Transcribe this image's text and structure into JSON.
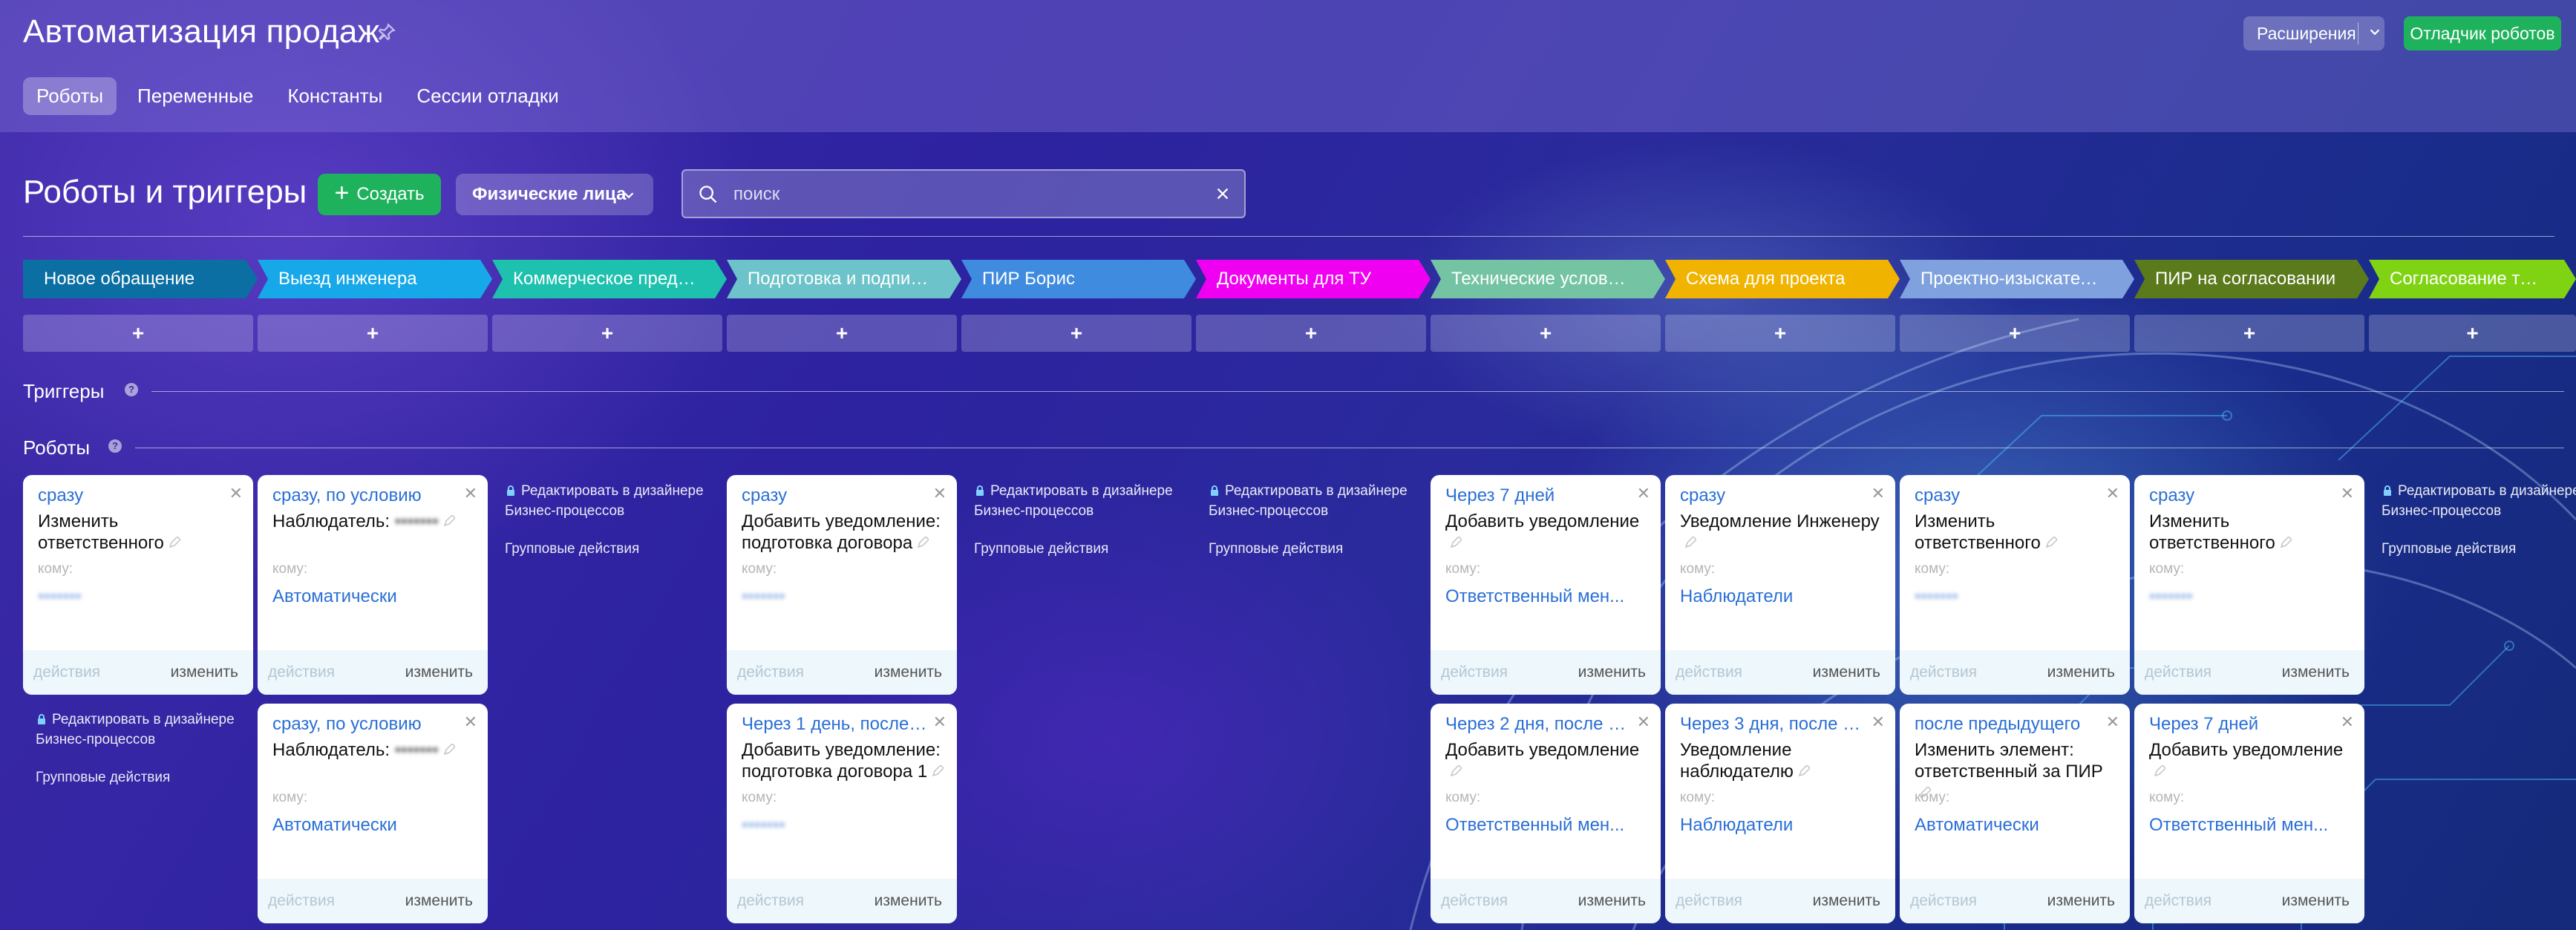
{
  "header": {
    "title": "Автоматизация продаж",
    "tabs": [
      {
        "label": "Роботы",
        "active": true
      },
      {
        "label": "Переменные"
      },
      {
        "label": "Константы"
      },
      {
        "label": "Сессии отладки"
      }
    ],
    "extensions_label": "Расширения",
    "debugger_label": "Отладчик роботов"
  },
  "toolbar": {
    "heading": "Роботы и триггеры",
    "create_label": "Создать",
    "filter_label": "Физические лица",
    "search_placeholder": "поиск"
  },
  "stages": [
    {
      "name": "Новое обращение",
      "color": "#0b6fa3"
    },
    {
      "name": "Выезд инженера",
      "color": "#16a8e8"
    },
    {
      "name": "Коммерческое предло...",
      "color": "#1ec1ae"
    },
    {
      "name": "Подготовка и подписа...",
      "color": "#6cc3c9"
    },
    {
      "name": "ПИР Борис",
      "color": "#3f8be0"
    },
    {
      "name": "Документы для ТУ",
      "color": "#f000f0"
    },
    {
      "name": "Технические условия (...",
      "color": "#74c4a4"
    },
    {
      "name": "Схема для проекта",
      "color": "#f0b400"
    },
    {
      "name": "Проектно-изыскательс...",
      "color": "#7fa2df"
    },
    {
      "name": "ПИР на согласовании",
      "color": "#5a7a1c"
    },
    {
      "name": "Согласование точки в...",
      "color": "#7fd313"
    }
  ],
  "add_label": "+",
  "sections": {
    "triggers": "Триггеры",
    "robots": "Роботы",
    "help": "?"
  },
  "common": {
    "to_label": "кому:",
    "actions_label": "действия",
    "edit_label": "изменить",
    "designer_line1": "Редактировать в дизайнере",
    "designer_line2": "Бизнес-процессов",
    "group_actions": "Групповые действия",
    "masked": "•••••••"
  },
  "cards": [
    {
      "title": "сразу",
      "body": "Изменить ответственного",
      "value": "•••••••",
      "blur": true
    },
    {
      "title": "сразу, по условию",
      "body": "Наблюдатель:",
      "body_blur": "•••••••",
      "value": "Автоматически"
    },
    {
      "title": "сразу",
      "body": "Добавить уведомление: подготовка договора",
      "value": "•••••••",
      "blur": true
    },
    {
      "title": "Через 7 дней",
      "body": "Добавить уведомление",
      "value": "Ответственный мен..."
    },
    {
      "title": "сразу",
      "body": "Уведомление Инженеру",
      "value": "Наблюдатели"
    },
    {
      "title": "сразу",
      "body": "Изменить ответственного",
      "value": "•••••••",
      "blur": true
    },
    {
      "title": "сразу",
      "body": "Изменить ответственного",
      "value": "•••••••",
      "blur": true
    },
    {
      "title": "сразу, по условию",
      "body": "Наблюдатель:",
      "body_blur": "•••••••",
      "value": "Автоматически"
    },
    {
      "title": "Через 1 день, после п...",
      "body": "Добавить уведомление: подготовка договора 1",
      "value": "•••••••",
      "blur": true
    },
    {
      "title": "Через 2 дня, после пр...",
      "body": "Добавить уведомление",
      "value": "Ответственный мен..."
    },
    {
      "title": "Через 3 дня, после пр...",
      "body": "Уведомление наблюдателю",
      "value": "Наблюдатели"
    },
    {
      "title": "после предыдущего",
      "body": "Изменить элемент: ответственный за ПИР",
      "value": "Автоматически"
    },
    {
      "title": "Через 7 дней",
      "body": "Добавить уведомление",
      "value": "Ответственный мен..."
    }
  ]
}
